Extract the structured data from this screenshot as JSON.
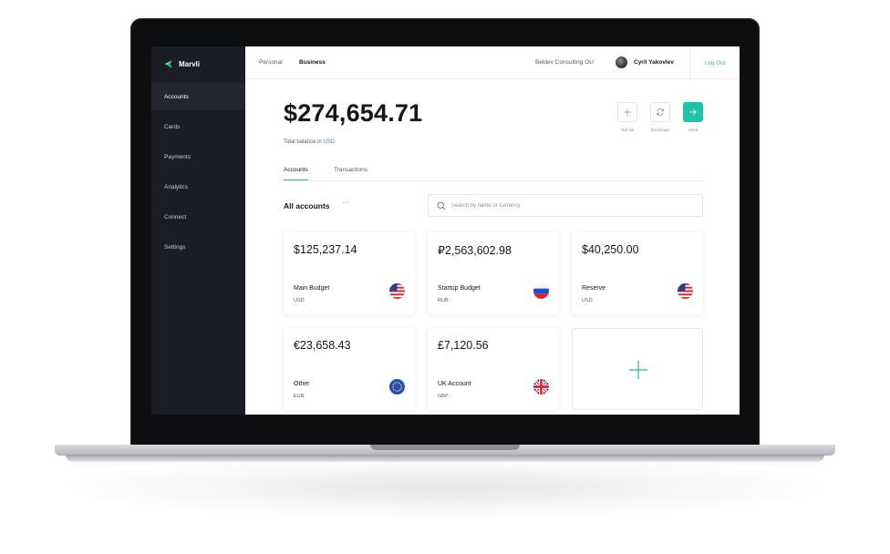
{
  "app": {
    "brand": "Marvli"
  },
  "colors": {
    "accent": "#1fc2a9",
    "sidebar": "#1b1d24",
    "link": "#2a84d6"
  },
  "sidebar": {
    "items": [
      {
        "label": "Accounts",
        "active": true
      },
      {
        "label": "Cards",
        "active": false
      },
      {
        "label": "Payments",
        "active": false
      },
      {
        "label": "Analytics",
        "active": false
      },
      {
        "label": "Connect",
        "active": false
      },
      {
        "label": "Settings",
        "active": false
      }
    ]
  },
  "header": {
    "modes": [
      {
        "label": "Personal",
        "active": false
      },
      {
        "label": "Business",
        "active": true
      }
    ],
    "company": "Beldev Consulting OU",
    "user_name": "Cyril Yakovlev",
    "logout": "Log Out"
  },
  "balance": {
    "amount": "$274,654.71",
    "label_prefix": "Total balance in",
    "currency": "USD"
  },
  "actions": [
    {
      "label": "Top Up",
      "icon": "plus-icon"
    },
    {
      "label": "Exchange",
      "icon": "refresh-icon"
    },
    {
      "label": "Send",
      "icon": "arrow-right-icon"
    }
  ],
  "tabs": [
    {
      "label": "Accounts",
      "active": true
    },
    {
      "label": "Transactions",
      "active": false
    }
  ],
  "accounts_section": {
    "title": "All accounts",
    "more": "···",
    "search_placeholder": "Search by name or currency"
  },
  "accounts": [
    {
      "amount": "$125,237.14",
      "name": "Main Budget",
      "currency": "USD",
      "flag": "us-flag-icon"
    },
    {
      "amount": "₽2,563,602.98",
      "name": "Startup Budget",
      "currency": "RUB",
      "flag": "ru-flag-icon"
    },
    {
      "amount": "$40,250.00",
      "name": "Reserve",
      "currency": "USD",
      "flag": "us-flag-icon"
    },
    {
      "amount": "€23,658.43",
      "name": "Other",
      "currency": "EUR",
      "flag": "eu-flag-icon"
    },
    {
      "amount": "£7,120.56",
      "name": "UK Account",
      "currency": "GBP",
      "flag": "uk-flag-icon"
    }
  ],
  "add_account": {
    "icon": "plus-icon"
  }
}
